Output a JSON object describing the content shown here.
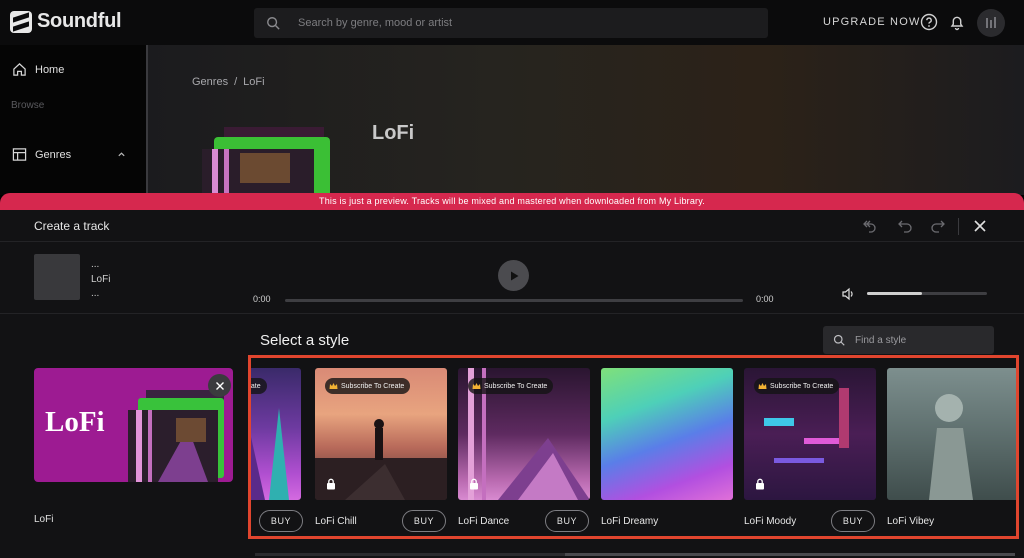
{
  "app": {
    "name": "Soundful"
  },
  "topbar": {
    "search_placeholder": "Search by genre, mood or artist",
    "upgrade_label": "UPGRADE NOW"
  },
  "sidebar": {
    "home_label": "Home",
    "browse_label": "Browse",
    "genres_label": "Genres"
  },
  "hero": {
    "breadcrumb": [
      "Genres",
      "/",
      "LoFi"
    ],
    "title": "LoFi"
  },
  "banner": {
    "text": "This is just a preview. Tracks will be mixed and mastered when downloaded from My Library."
  },
  "panel": {
    "title": "Create a track",
    "track": {
      "line1": "...",
      "line2": "LoFi",
      "line3": "..."
    },
    "time_current": "0:00",
    "time_total": "0:00",
    "volume_level": 0.46
  },
  "styles": {
    "heading": "Select a style",
    "search_placeholder": "Find a style",
    "selected_genre": {
      "card_text": "LoFi",
      "label": "LoFi"
    },
    "items": [
      {
        "name": "",
        "badge": "eate",
        "locked": false,
        "buy_label": "BUY"
      },
      {
        "name": "LoFi Chill",
        "badge": "Subscribe To Create",
        "locked": true,
        "buy_label": "BUY"
      },
      {
        "name": "LoFi Dance",
        "badge": "Subscribe To Create",
        "locked": true,
        "buy_label": "BUY"
      },
      {
        "name": "LoFi Dreamy",
        "badge": "",
        "locked": false,
        "buy_label": ""
      },
      {
        "name": "LoFi Moody",
        "badge": "Subscribe To Create",
        "locked": true,
        "buy_label": "BUY"
      },
      {
        "name": "LoFi Vibey",
        "badge": "",
        "locked": false,
        "buy_label": ""
      }
    ]
  },
  "colors": {
    "banner": "#d6284e",
    "highlight_border": "#e0452e",
    "genre_card": "#9d1b92",
    "badge_crown": "#f2b233"
  }
}
